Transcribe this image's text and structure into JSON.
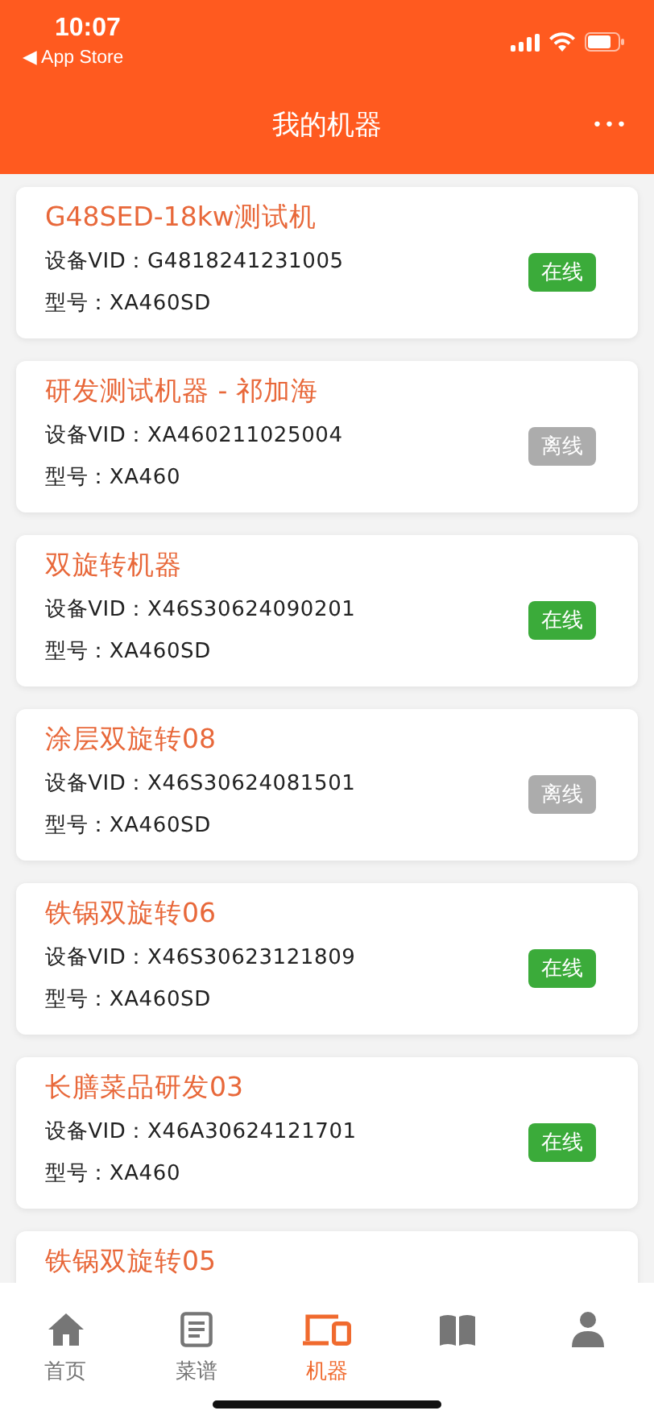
{
  "status_bar": {
    "time": "10:07",
    "back_label": "◀ App Store"
  },
  "nav_bar": {
    "title": "我的机器",
    "more": "•••"
  },
  "devices": [
    {
      "name": "G48SED-18kw测试机",
      "vid": "设备VID：G4818241231005",
      "model": "型号：XA460SD",
      "online": true,
      "status": "在线"
    },
    {
      "name": "研发测试机器 - 祁加海",
      "vid": "设备VID：XA460211025004",
      "model": "型号：XA460",
      "online": false,
      "status": "离线"
    },
    {
      "name": "双旋转机器",
      "vid": "设备VID：X46S30624090201",
      "model": "型号：XA460SD",
      "online": true,
      "status": "在线"
    },
    {
      "name": "涂层双旋转08",
      "vid": "设备VID：X46S30624081501",
      "model": "型号：XA460SD",
      "online": false,
      "status": "离线"
    },
    {
      "name": "铁锅双旋转06",
      "vid": "设备VID：X46S30623121809",
      "model": "型号：XA460SD",
      "online": true,
      "status": "在线"
    },
    {
      "name": "长膳菜品研发03",
      "vid": "设备VID：X46A30624121701",
      "model": "型号：XA460",
      "online": true,
      "status": "在线"
    },
    {
      "name": "铁锅双旋转05"
    }
  ],
  "tab_bar": [
    {
      "kind": "home",
      "label": "首页",
      "selected": false
    },
    {
      "kind": "recipe",
      "label": "菜谱",
      "selected": false
    },
    {
      "kind": "device",
      "label": "机器",
      "selected": true
    },
    {
      "kind": "book",
      "selected": false
    },
    {
      "kind": "person",
      "selected": false
    }
  ]
}
